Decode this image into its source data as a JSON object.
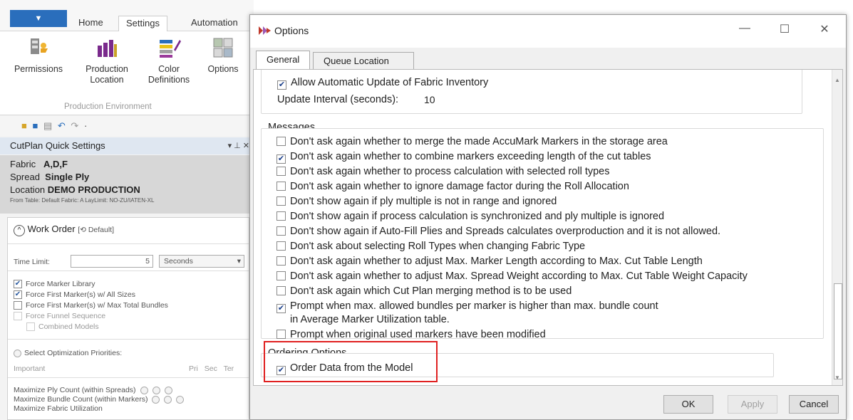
{
  "ribbon": {
    "tabs": [
      "Home",
      "Settings",
      "Automation"
    ],
    "buttons": {
      "permissions": "Permissions",
      "production_location_1": "Production",
      "production_location_2": "Location",
      "color_definitions_1": "Color",
      "color_definitions_2": "Definitions",
      "options": "Options"
    },
    "group_label": "Production Environment"
  },
  "quick_settings": {
    "title": "CutPlan Quick Settings",
    "pin": "▾ ⊥ ✕",
    "fabric_label": "Fabric",
    "fabric_value": "A,D,F",
    "spread_label": "Spread",
    "spread_value": "Single Ply",
    "location_label": "Location",
    "location_value": "DEMO PRODUCTION",
    "source_line": "From Table: Default Fabric: A LayLimit: NO-ZU/IATEN-XL"
  },
  "work_order": {
    "title": "Work Order",
    "default_tag": "[⟲ Default]",
    "time_limit_label": "Time Limit:",
    "time_limit_value": "5",
    "time_unit": "Seconds",
    "options": [
      {
        "label": "Force Marker Library",
        "checked": true
      },
      {
        "label": "Force First Marker(s) w/ All Sizes",
        "checked": true
      },
      {
        "label": "Force First Marker(s) w/ Max Total Bundles",
        "checked": false
      },
      {
        "label": "Force Funnel Sequence",
        "checked": false
      },
      {
        "label": "Combined Models",
        "checked": false
      }
    ],
    "priorities_label": "Select Optimization Priorities:",
    "importance_label": "Important",
    "priority_columns": [
      "Pri",
      "Sec",
      "Ter"
    ],
    "priorities": [
      "Maximize Ply Count (within Spreads)",
      "Maximize Bundle Count (within Markers)",
      "Maximize Fabric Utilization"
    ]
  },
  "dialog": {
    "title": "Options",
    "tabs": [
      "General",
      "Queue Location"
    ],
    "fabric": {
      "auto_update_label": "Allow Automatic Update of Fabric Inventory",
      "auto_update_checked": true,
      "interval_label": "Update Interval (seconds):",
      "interval_value": "10"
    },
    "messages": {
      "title": "Messages",
      "items": [
        {
          "label": "Don't ask again whether to merge the made AccuMark Markers in the storage area",
          "checked": false
        },
        {
          "label": "Don't ask again whether to combine markers exceeding length of the cut tables",
          "checked": true
        },
        {
          "label": "Don't ask again whether to process calculation with selected roll types",
          "checked": false
        },
        {
          "label": "Don't ask again whether to ignore damage factor during the Roll Allocation",
          "checked": false
        },
        {
          "label": "Don't show again if ply multiple is not in range and ignored",
          "checked": false
        },
        {
          "label": "Don't show again if process calculation is synchronized and ply multiple is ignored",
          "checked": false
        },
        {
          "label": "Don't show again if Auto-Fill Plies and Spreads calculates overproduction and it is not allowed.",
          "checked": false
        },
        {
          "label": "Don't ask about selecting Roll Types when changing Fabric Type",
          "checked": false
        },
        {
          "label": "Don't ask again whether to adjust Max. Marker Length according to Max. Cut Table Length",
          "checked": false
        },
        {
          "label": "Don't ask again whether to adjust Max. Spread Weight according to Max. Cut Table Weight Capacity",
          "checked": false
        },
        {
          "label": "Don't ask again which Cut Plan merging method is to be used",
          "checked": false
        },
        {
          "label": "Prompt when max. allowed bundles per marker is higher than max. bundle count",
          "checked": true
        },
        {
          "label": "in Average Marker Utilization table.",
          "checked": null
        },
        {
          "label": "Prompt when original used markers have been modified",
          "checked": false
        }
      ]
    },
    "ordering": {
      "title": "Ordering Options",
      "label": "Order Data from the Model",
      "checked": true
    },
    "buttons": {
      "ok": "OK",
      "apply": "Apply",
      "cancel": "Cancel"
    },
    "window_controls": {
      "minimize": "—",
      "maximize": "☐",
      "close": "✕"
    },
    "check_glyph": "✔"
  }
}
